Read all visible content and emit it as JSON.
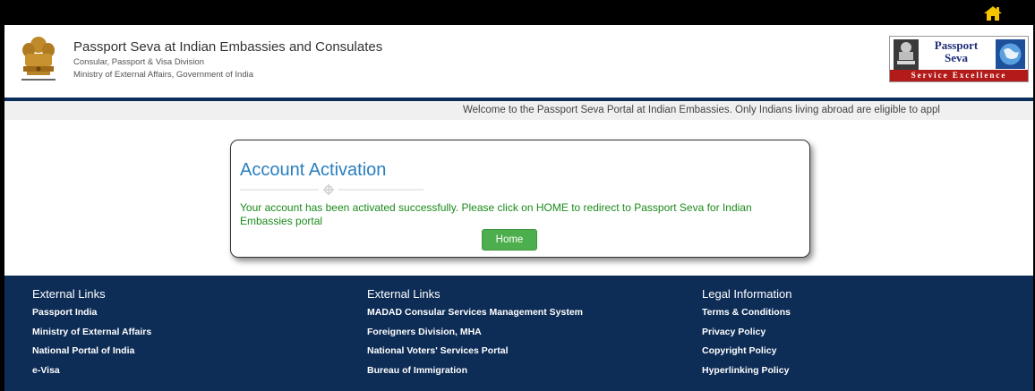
{
  "header": {
    "title": "Passport Seva at Indian Embassies and Consulates",
    "subtitle": "Consular, Passport & Visa Division",
    "ministry": "Ministry of External Affairs, Government of India",
    "emblem_icon": "state-emblem-icon",
    "logo": {
      "line1": "Passport",
      "line2": "Seva",
      "band": "Service Excellence"
    }
  },
  "topbar": {
    "home_icon": "home-icon"
  },
  "ticker": {
    "text": "Welcome to the Passport Seva Portal at Indian Embassies. Only Indians living abroad are eligible to appl"
  },
  "card": {
    "title": "Account Activation",
    "message": "Your account has been activated successfully. Please click on HOME to redirect to Passport Seva for Indian Embassies portal",
    "home_button": "Home"
  },
  "footer": {
    "columns": [
      {
        "heading": "External Links",
        "links": [
          "Passport India",
          "Ministry of External Affairs",
          "National Portal of India",
          "e-Visa"
        ]
      },
      {
        "heading": "External Links",
        "links": [
          "MADAD Consular Services Management System",
          "Foreigners Division, MHA",
          "National Voters' Services Portal",
          "Bureau of Immigration"
        ]
      },
      {
        "heading": "Legal Information",
        "links": [
          "Terms & Conditions",
          "Privacy Policy",
          "Copyright Policy",
          "Hyperlinking Policy"
        ]
      }
    ]
  },
  "colors": {
    "navy": "#0d2c56",
    "title_blue": "#2a7fbf",
    "success_green": "#1a8a1a",
    "button_green": "#4cae4c"
  }
}
